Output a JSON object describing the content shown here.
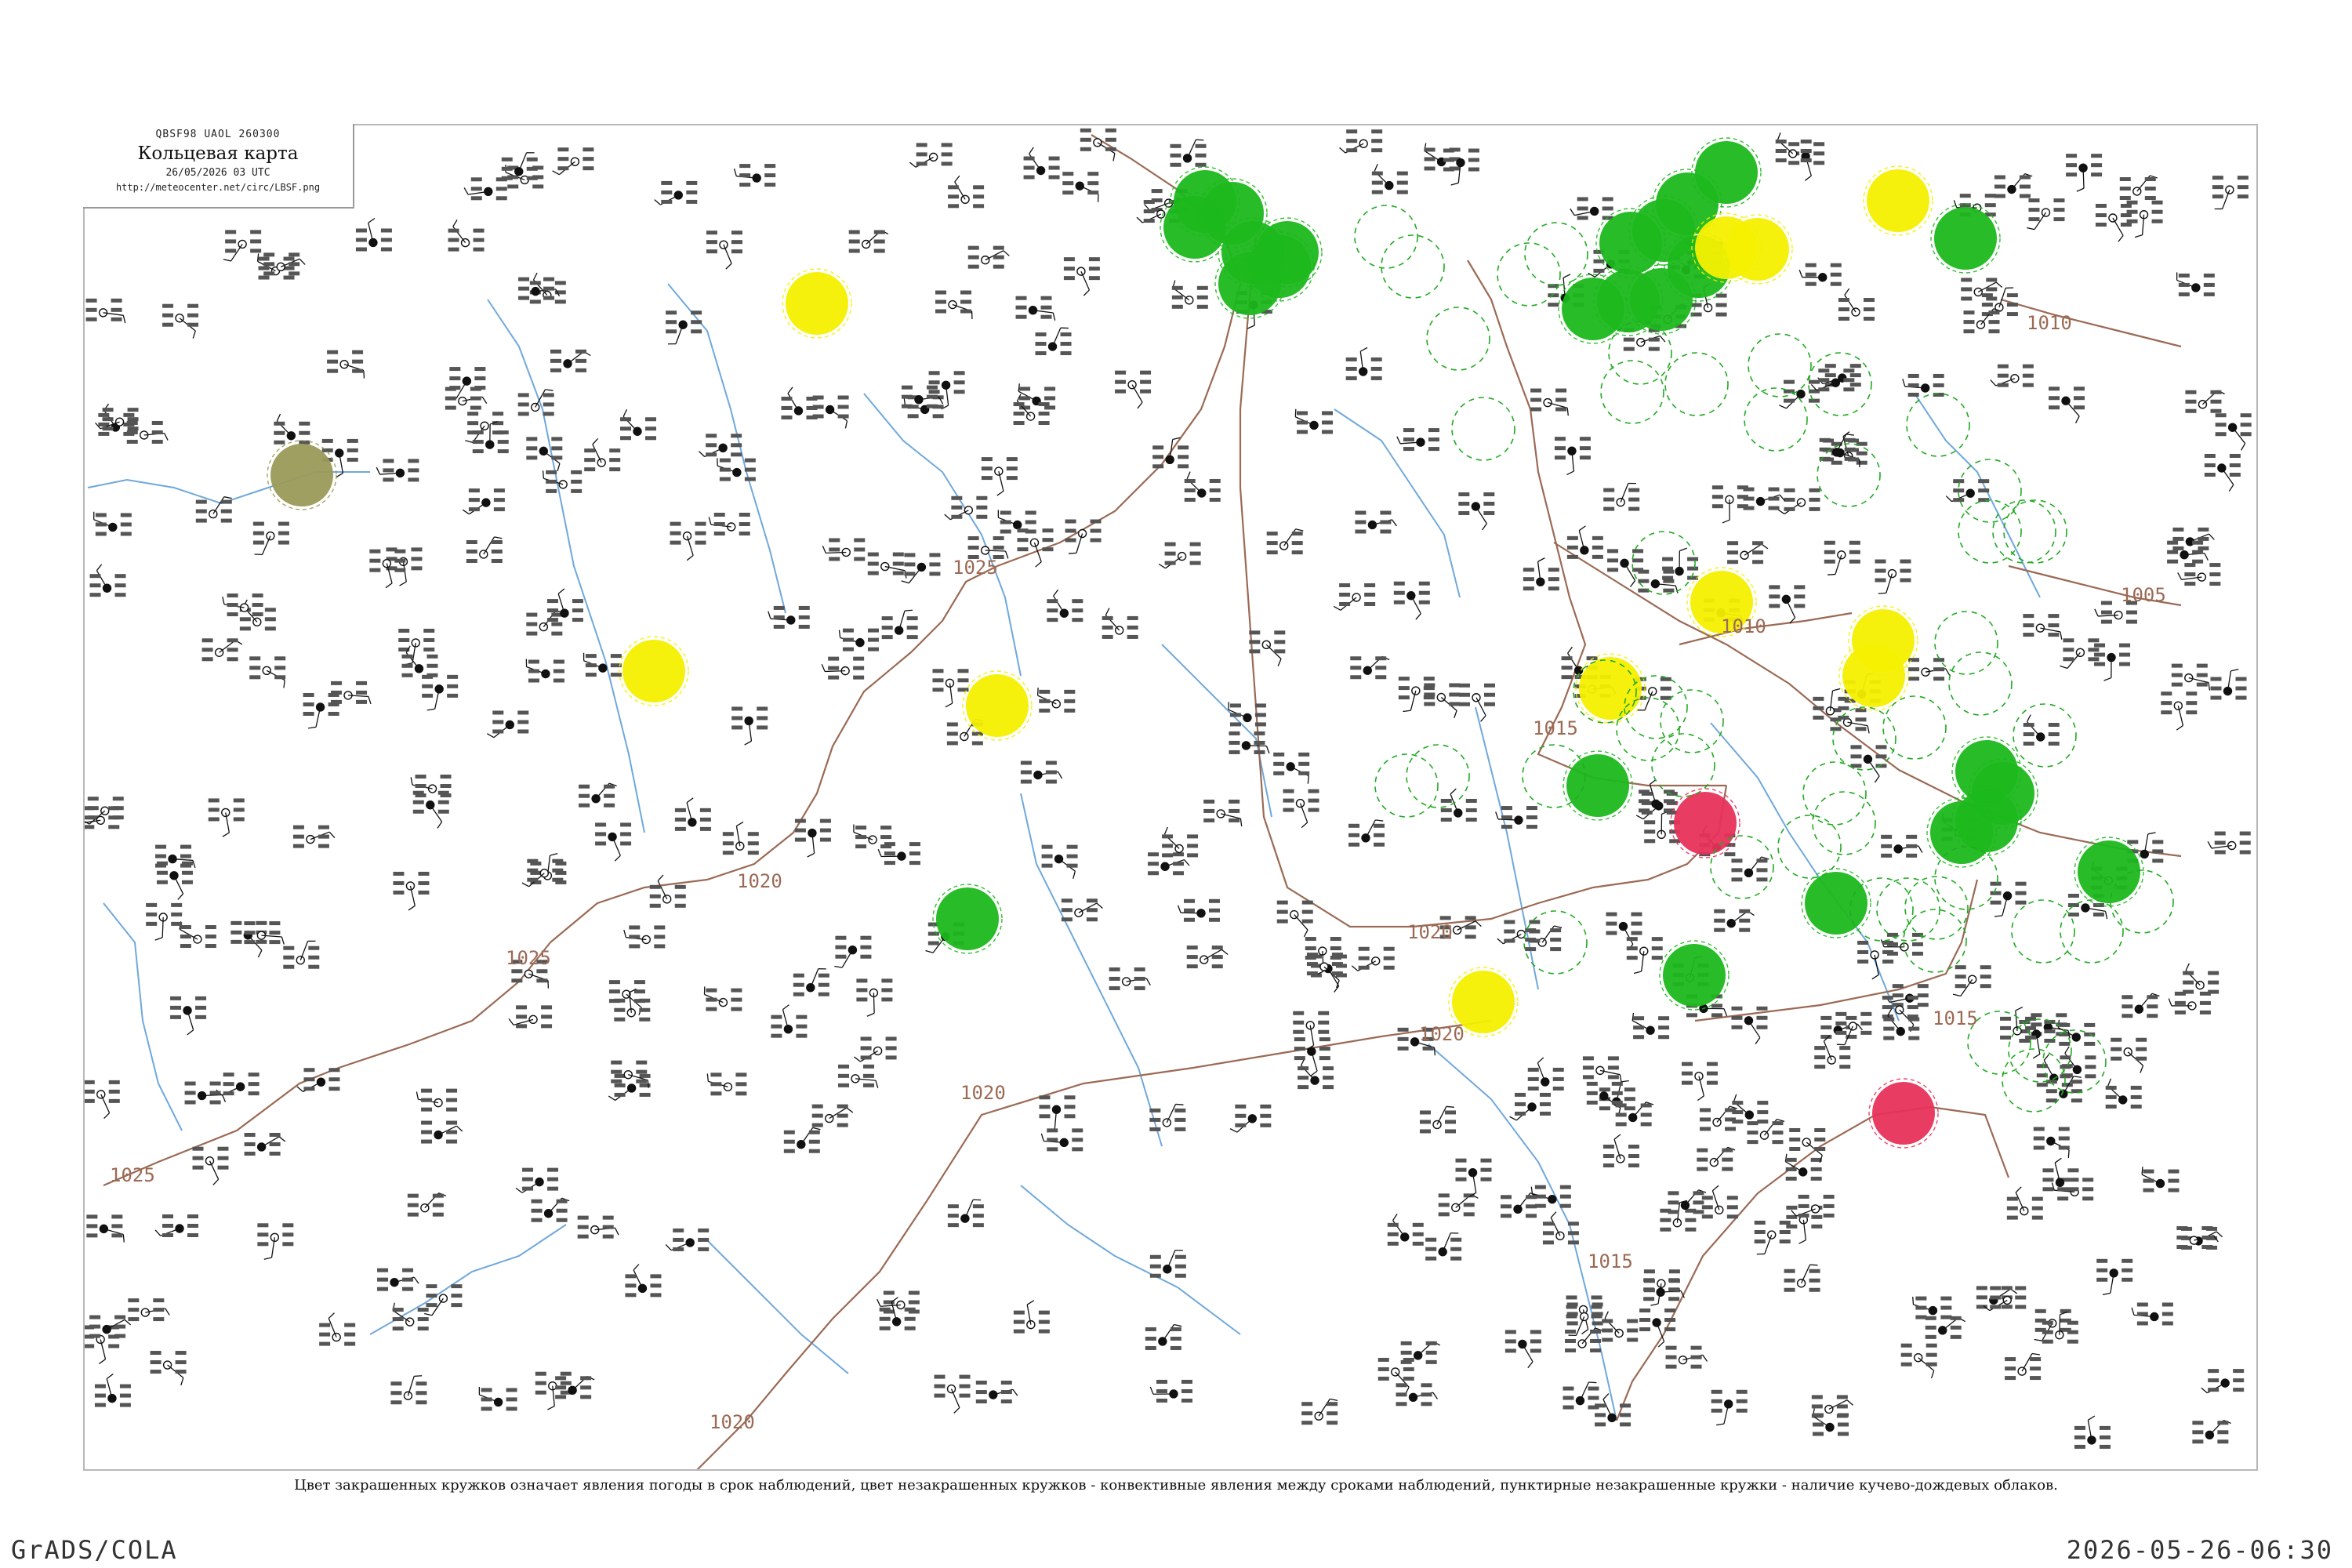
{
  "header": {
    "code_line": "QBSF98  UAOL  260300",
    "title": "Кольцевая карта",
    "datetime": "26/05/2026 03 UTC",
    "url": "http://meteocenter.net/circ/LBSF.png"
  },
  "caption": "Цвет закрашенных кружков означает явления погоды в срок наблюдений, цвет незакрашенных кружков - конвективные явления между сроками наблюдений, пунктирные незакрашенные кружки - наличие кучево-дождевых облаков.",
  "footer": {
    "left": "GrADS/COLA",
    "right": "2026-05-26-06:30"
  },
  "isobars": [
    {
      "label": "1025"
    },
    {
      "label": "1025"
    },
    {
      "label": "1025"
    },
    {
      "label": "1025"
    },
    {
      "label": "1020"
    },
    {
      "label": "1020"
    },
    {
      "label": "1020"
    },
    {
      "label": "1020"
    },
    {
      "label": "1020"
    },
    {
      "label": "1015"
    },
    {
      "label": "1015"
    },
    {
      "label": "1015"
    },
    {
      "label": "1010"
    },
    {
      "label": "1005"
    },
    {
      "label": "1010"
    }
  ],
  "legend_colors": {
    "precipitation_fill": "#1cb81c",
    "shower_or_fog_fill": "#f4f000",
    "thunderstorm_fill": "#e8325a",
    "dust_fill": "#9a9a5a",
    "convective_outline": "#22aa22",
    "isobar_line": "#9b6a55",
    "river": "#6fa8dc"
  }
}
